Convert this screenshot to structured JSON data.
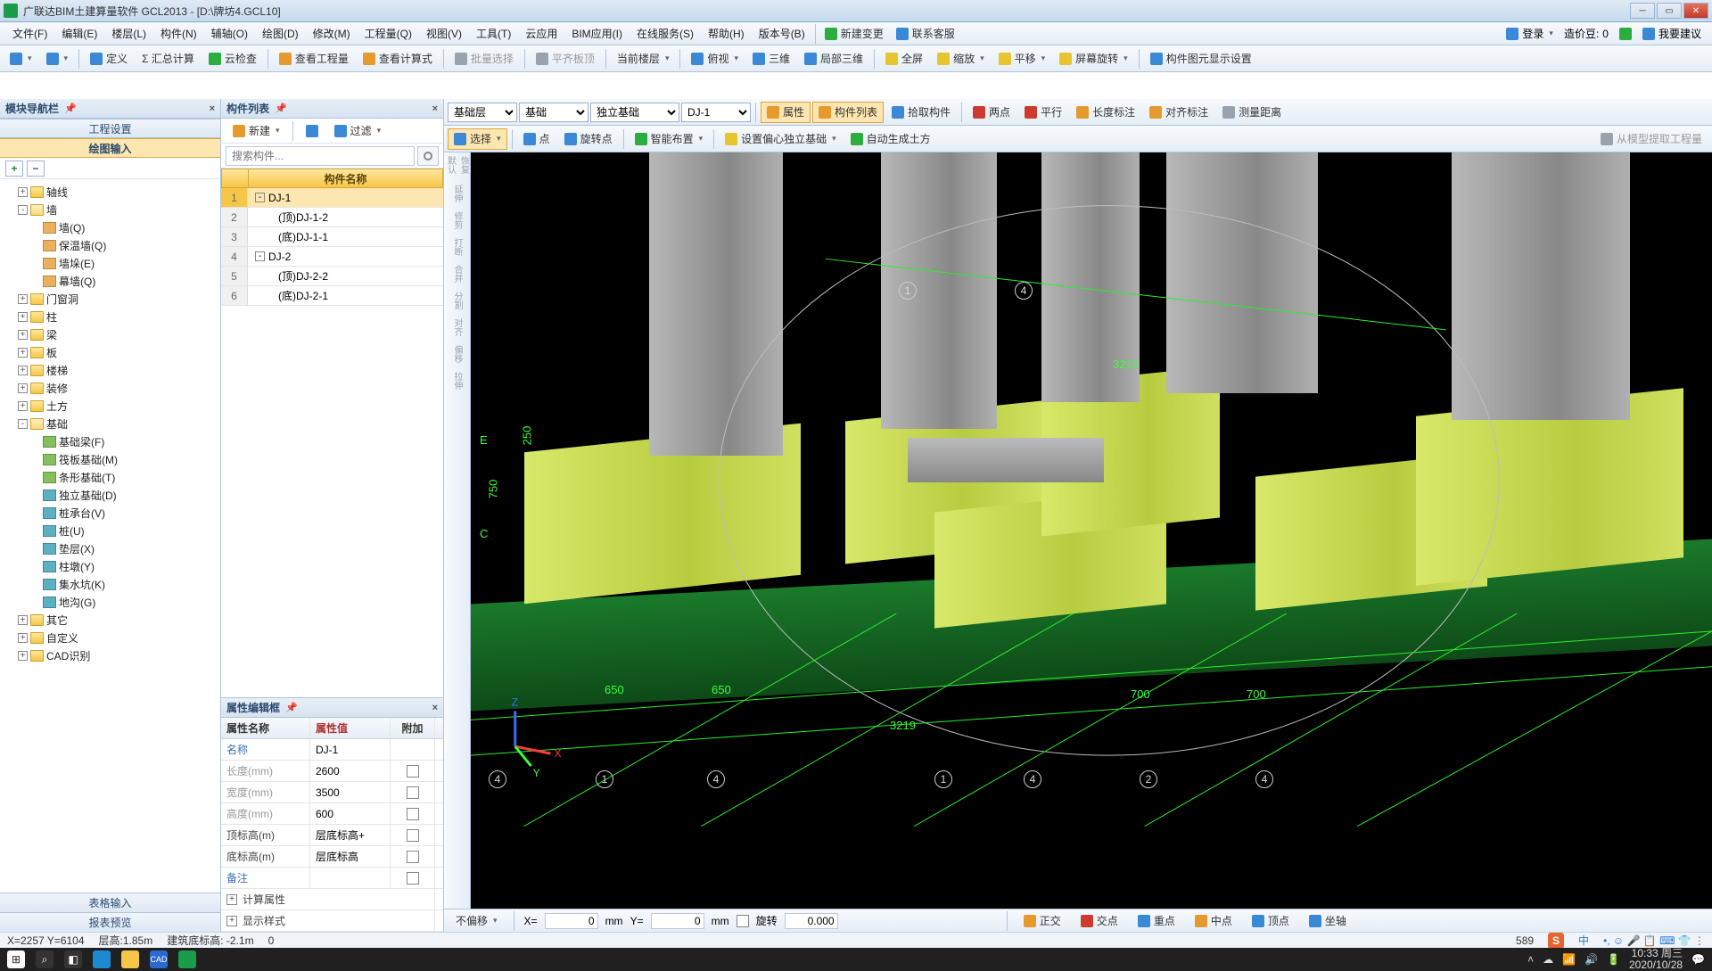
{
  "title": "广联达BIM土建算量软件 GCL2013 - [D:\\牌坊4.GCL10]",
  "menu": [
    "文件(F)",
    "编辑(E)",
    "楼层(L)",
    "构件(N)",
    "辅轴(O)",
    "绘图(D)",
    "修改(M)",
    "工程量(Q)",
    "视图(V)",
    "工具(T)",
    "云应用",
    "BIM应用(I)",
    "在线服务(S)",
    "帮助(H)",
    "版本号(B)"
  ],
  "menuRight": {
    "new": "新建变更",
    "contact": "联系客服",
    "login": "登录",
    "credit_lbl": "造价豆:",
    "credit_val": "0",
    "suggest": "我要建议"
  },
  "tb1": {
    "define": "定义",
    "sumcalc": "Σ 汇总计算",
    "cloudcheck": "云检查",
    "viewqty": "查看工程量",
    "viewcalc": "查看计算式",
    "batchsel": "批量选择",
    "flatroof": "平齐板顶",
    "curfloor": "当前楼层",
    "f«": "俯视",
    "三维": "三维",
    "局部": "局部三维",
    "full": "全屏",
    "zoom": "缩放",
    "pan": "平移",
    "rot": "屏幕旋转",
    "dispset": "构件图元显示设置"
  },
  "tb2": {
    "sel": [
      "基础层",
      "基础",
      "独立基础",
      "DJ-1"
    ],
    "attr": "属性",
    "complist": "构件列表",
    "pick": "拾取构件",
    "twop": "两点",
    "parallel": "平行",
    "dimlen": "长度标注",
    "dimalign": "对齐标注",
    "measure": "测量距离"
  },
  "tb3": {
    "select": "选择",
    "point": "点",
    "rotpt": "旋转点",
    "smart": "智能布置",
    "eccfound": "设置偏心独立基础",
    "autoearth": "自动生成土方",
    "extract": "从模型提取工程量"
  },
  "leftPanel": {
    "title": "模块导航栏",
    "seg1": "工程设置",
    "seg2": "绘图输入",
    "bottom1": "表格输入",
    "bottom2": "报表预览"
  },
  "tree": [
    {
      "lvl": 0,
      "exp": "+",
      "type": "fold",
      "label": "轴线"
    },
    {
      "lvl": 0,
      "exp": "-",
      "type": "fold",
      "label": "墙",
      "open": true
    },
    {
      "lvl": 1,
      "type": "leaf",
      "cls": "c1",
      "label": "墙(Q)"
    },
    {
      "lvl": 1,
      "type": "leaf",
      "cls": "c1",
      "label": "保温墙(Q)"
    },
    {
      "lvl": 1,
      "type": "leaf",
      "cls": "c1",
      "label": "墙垛(E)"
    },
    {
      "lvl": 1,
      "type": "leaf",
      "cls": "c1",
      "label": "幕墙(Q)"
    },
    {
      "lvl": 0,
      "exp": "+",
      "type": "fold",
      "label": "门窗洞"
    },
    {
      "lvl": 0,
      "exp": "+",
      "type": "fold",
      "label": "柱"
    },
    {
      "lvl": 0,
      "exp": "+",
      "type": "fold",
      "label": "梁"
    },
    {
      "lvl": 0,
      "exp": "+",
      "type": "fold",
      "label": "板"
    },
    {
      "lvl": 0,
      "exp": "+",
      "type": "fold",
      "label": "楼梯"
    },
    {
      "lvl": 0,
      "exp": "+",
      "type": "fold",
      "label": "装修"
    },
    {
      "lvl": 0,
      "exp": "+",
      "type": "fold",
      "label": "土方"
    },
    {
      "lvl": 0,
      "exp": "-",
      "type": "fold",
      "label": "基础",
      "open": true
    },
    {
      "lvl": 1,
      "type": "leaf",
      "cls": "c2",
      "label": "基础梁(F)"
    },
    {
      "lvl": 1,
      "type": "leaf",
      "cls": "c2",
      "label": "筏板基础(M)"
    },
    {
      "lvl": 1,
      "type": "leaf",
      "cls": "c2",
      "label": "条形基础(T)"
    },
    {
      "lvl": 1,
      "type": "leaf",
      "cls": "c3",
      "label": "独立基础(D)"
    },
    {
      "lvl": 1,
      "type": "leaf",
      "cls": "c3",
      "label": "桩承台(V)"
    },
    {
      "lvl": 1,
      "type": "leaf",
      "cls": "c3",
      "label": "桩(U)"
    },
    {
      "lvl": 1,
      "type": "leaf",
      "cls": "c3",
      "label": "垫层(X)"
    },
    {
      "lvl": 1,
      "type": "leaf",
      "cls": "c3",
      "label": "柱墩(Y)"
    },
    {
      "lvl": 1,
      "type": "leaf",
      "cls": "c3",
      "label": "集水坑(K)"
    },
    {
      "lvl": 1,
      "type": "leaf",
      "cls": "c3",
      "label": "地沟(G)"
    },
    {
      "lvl": 0,
      "exp": "+",
      "type": "fold",
      "label": "其它"
    },
    {
      "lvl": 0,
      "exp": "+",
      "type": "fold",
      "label": "自定义"
    },
    {
      "lvl": 0,
      "exp": "+",
      "type": "fold",
      "label": "CAD识别"
    }
  ],
  "compPanel": {
    "title": "构件列表",
    "new": "新建",
    "filter": "过滤",
    "searchPH": "搜索构件...",
    "header": "构件名称"
  },
  "compRows": [
    {
      "n": "1",
      "exp": "-",
      "txt": "DJ-1",
      "sel": true,
      "lvl": 0
    },
    {
      "n": "2",
      "txt": "(顶)DJ-1-2",
      "lvl": 1
    },
    {
      "n": "3",
      "txt": "(底)DJ-1-1",
      "lvl": 1
    },
    {
      "n": "4",
      "exp": "-",
      "txt": "DJ-2",
      "lvl": 0
    },
    {
      "n": "5",
      "txt": "(顶)DJ-2-2",
      "lvl": 1
    },
    {
      "n": "6",
      "txt": "(底)DJ-2-1",
      "lvl": 1
    }
  ],
  "propPanel": {
    "title": "属性编辑框",
    "h1": "属性名称",
    "h2": "属性值",
    "h3": "附加"
  },
  "propRows": [
    {
      "n": "名称",
      "v": "DJ-1",
      "blue": true,
      "chk": false
    },
    {
      "n": "长度(mm)",
      "v": "2600",
      "dim": true,
      "chk": true
    },
    {
      "n": "宽度(mm)",
      "v": "3500",
      "dim": true,
      "chk": true
    },
    {
      "n": "高度(mm)",
      "v": "600",
      "dim": true,
      "chk": true
    },
    {
      "n": "顶标高(m)",
      "v": "层底标高+",
      "chk": true
    },
    {
      "n": "底标高(m)",
      "v": "层底标高",
      "chk": true
    },
    {
      "n": "备注",
      "v": "",
      "blue": true,
      "chk": true
    }
  ],
  "propExp": [
    {
      "e": "+",
      "t": "计算属性"
    },
    {
      "e": "+",
      "t": "显示样式"
    }
  ],
  "vtools": [
    "恢复默认",
    "延伸",
    "修剪",
    "打断",
    "合并",
    "分割",
    "对齐",
    "偏移",
    "拉伸"
  ],
  "vpstatus": {
    "offset": "不偏移",
    "x": "X=",
    "xv": "0",
    "xu": "mm",
    "y": "Y=",
    "yv": "0",
    "yu": "mm",
    "rotchk": "旋转",
    "rotv": "0.000",
    "ortho": "正交",
    "inter": "交点",
    "grav": "重点",
    "mid": "中点",
    "vert": "顶点",
    "axis": "坐轴"
  },
  "status": {
    "coord": "X=2257 Y=6104",
    "floorH": "层高:1.85m",
    "baseElev": "建筑底标高: -2.1m",
    "zero": "0",
    "num": "589"
  },
  "gridNums": {
    "top1": "1",
    "top4": "4",
    "dim3219t": "3219",
    "dimE": "E",
    "dim250": "250",
    "dim750t": "750",
    "dimC": "C",
    "dim700": "700",
    "dim650": "650",
    "dim3219b": "3219",
    "dim700b": "700"
  },
  "taskbar": {
    "time": "10:33 周三",
    "date": "2020/10/28",
    "ime": "中"
  }
}
